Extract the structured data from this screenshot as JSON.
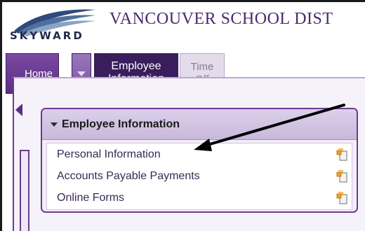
{
  "header": {
    "logo_text": "SKYWARD",
    "org_title": "VANCOUVER SCHOOL DIST"
  },
  "nav": {
    "home_label": "Home",
    "employee_line1": "Employee",
    "employee_line2": "Information",
    "time_line1": "Time",
    "time_line2": "Off"
  },
  "card": {
    "title": "Employee Information",
    "items": [
      {
        "label": "Personal Information"
      },
      {
        "label": "Accounts Payable Payments"
      },
      {
        "label": "Online Forms"
      }
    ]
  },
  "colors": {
    "brand_purple": "#5b2e84",
    "active_tab": "#3a1d5c",
    "title_purple": "#4b2a6b"
  },
  "icons": [
    "skyward-logo-swoosh-icon",
    "chevron-down-icon",
    "collapse-left-icon",
    "caret-down-icon",
    "pin-icon",
    "annotation-arrow"
  ]
}
